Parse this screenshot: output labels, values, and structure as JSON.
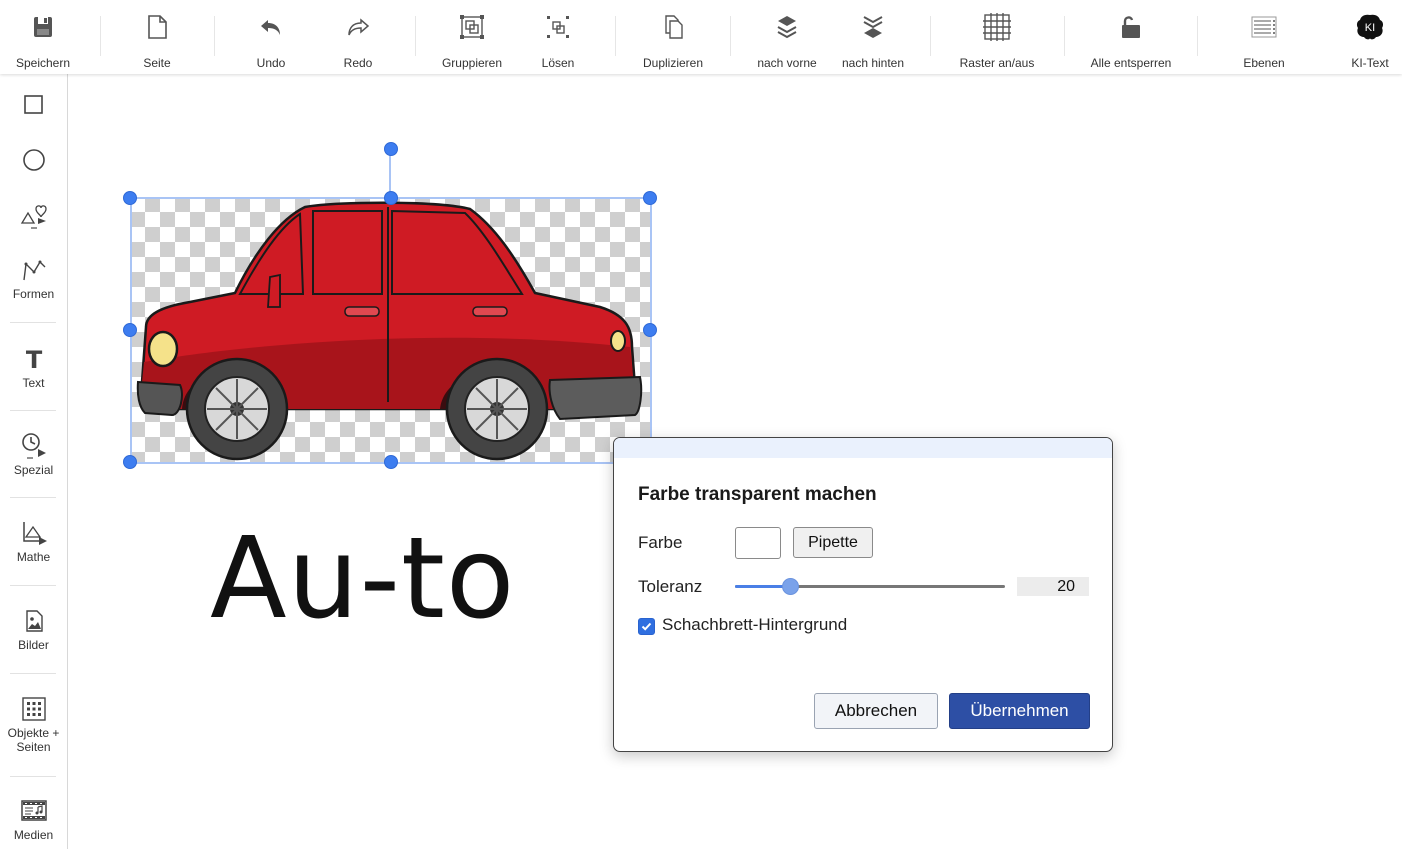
{
  "toolbar": {
    "items": [
      {
        "label": "Speichern",
        "icon": "floppy-icon"
      },
      {
        "label": "Seite",
        "icon": "page-icon"
      },
      {
        "label": "Undo",
        "icon": "undo-icon"
      },
      {
        "label": "Redo",
        "icon": "redo-icon"
      },
      {
        "label": "Gruppieren",
        "icon": "group-icon"
      },
      {
        "label": "Lösen",
        "icon": "ungroup-icon"
      },
      {
        "label": "Duplizieren",
        "icon": "duplicate-icon"
      },
      {
        "label": "nach vorne",
        "icon": "bring-forward-icon"
      },
      {
        "label": "nach hinten",
        "icon": "send-backward-icon"
      },
      {
        "label": "Raster an/aus",
        "icon": "grid-icon"
      },
      {
        "label": "Alle entsperren",
        "icon": "unlock-icon"
      },
      {
        "label": "Ebenen",
        "icon": "layers-list-icon"
      },
      {
        "label": "KI-Text",
        "icon": "ai-brain-icon",
        "icon_text": "KI"
      }
    ]
  },
  "sidebar": {
    "items": [
      {
        "label": "",
        "icon": "rectangle-icon"
      },
      {
        "label": "",
        "icon": "circle-icon"
      },
      {
        "label": "",
        "icon": "shapes-more-icon"
      },
      {
        "label": "Formen",
        "icon": "polyline-icon"
      },
      {
        "label": "Text",
        "icon": "text-icon",
        "icon_text": "T"
      },
      {
        "label": "Spezial",
        "icon": "clock-special-icon"
      },
      {
        "label": "Mathe",
        "icon": "math-icon"
      },
      {
        "label": "Bilder",
        "icon": "image-icon"
      },
      {
        "label": "Objekte + Seiten",
        "icon": "objects-grid-icon"
      },
      {
        "label": "Medien",
        "icon": "media-film-icon"
      }
    ]
  },
  "canvas": {
    "text": "Au-to",
    "image_object": "car-image",
    "car_color": "#cf1b24"
  },
  "dialog": {
    "title": "Farbe transparent machen",
    "color_label": "Farbe",
    "color_value": "#ffffff",
    "pipette_label": "Pipette",
    "tolerance_label": "Toleranz",
    "tolerance_value": 20,
    "tolerance_max": 100,
    "checkerboard_label": "Schachbrett-Hintergrund",
    "checkerboard_checked": true,
    "cancel_label": "Abbrechen",
    "apply_label": "Übernehmen"
  },
  "colors": {
    "accent": "#3d7df0",
    "apply_button": "#2d4fa5",
    "selection_frame": "#a9c4f5",
    "dialog_header": "#eaf1fd"
  }
}
